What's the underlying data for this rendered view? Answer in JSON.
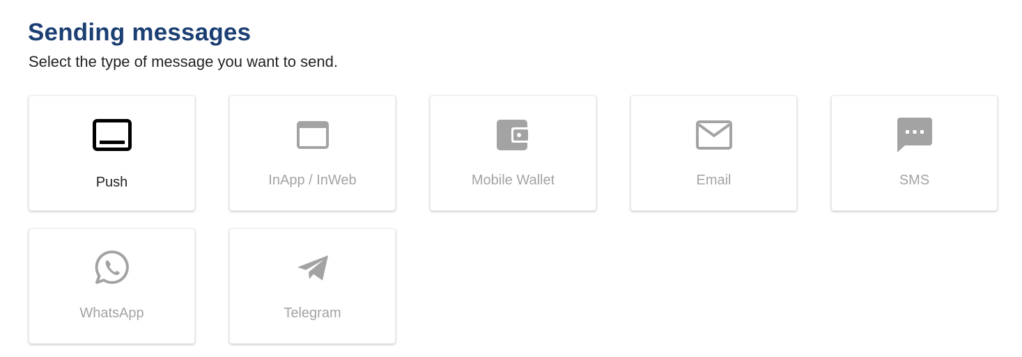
{
  "header": {
    "title": "Sending messages",
    "subtitle": "Select the type of message you want to send."
  },
  "colors": {
    "title": "#1b3f73",
    "active_text": "#222222",
    "inactive": "#a3a3a3"
  },
  "message_types": [
    {
      "label": "Push",
      "icon": "push-notification-icon",
      "selected": true
    },
    {
      "label": "InApp / InWeb",
      "icon": "browser-window-icon",
      "selected": false
    },
    {
      "label": "Mobile Wallet",
      "icon": "wallet-icon",
      "selected": false
    },
    {
      "label": "Email",
      "icon": "envelope-icon",
      "selected": false
    },
    {
      "label": "SMS",
      "icon": "chat-bubble-icon",
      "selected": false
    },
    {
      "label": "WhatsApp",
      "icon": "whatsapp-icon",
      "selected": false
    },
    {
      "label": "Telegram",
      "icon": "telegram-icon",
      "selected": false
    }
  ]
}
